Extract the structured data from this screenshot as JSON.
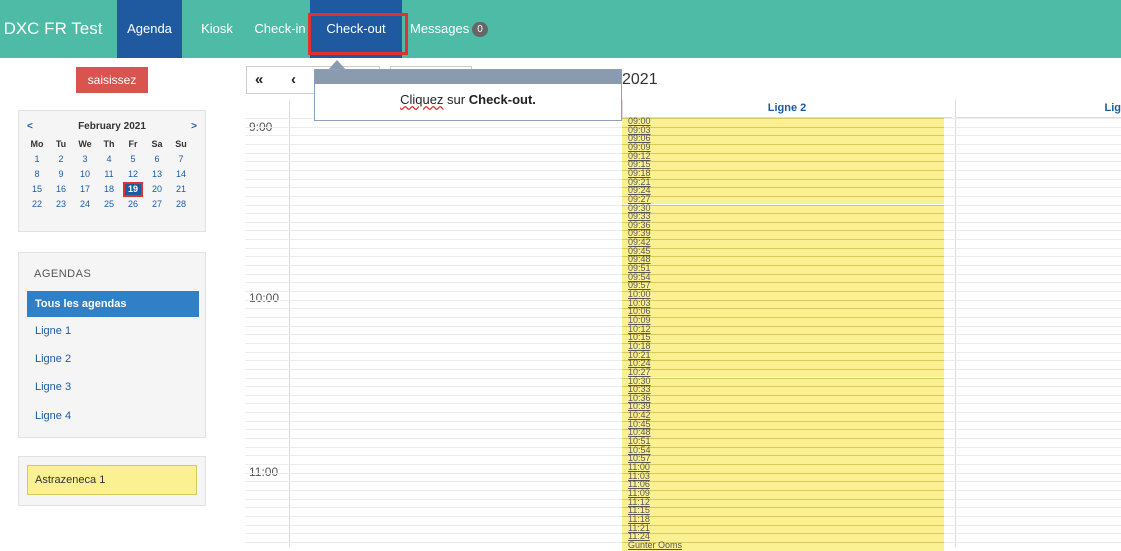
{
  "nav": {
    "brand": "DXC FR Test",
    "agenda": "Agenda",
    "kiosk": "Kiosk",
    "checkin": "Check-in",
    "checkout": "Check-out",
    "messages": "Messages",
    "messages_count": "0"
  },
  "sidebar": {
    "button": "saisissez",
    "calendar": {
      "prev": "<",
      "next": ">",
      "title": "February 2021",
      "dow": [
        "Mo",
        "Tu",
        "We",
        "Th",
        "Fr",
        "Sa",
        "Su"
      ],
      "weeks": [
        [
          "1",
          "2",
          "3",
          "4",
          "5",
          "6",
          "7"
        ],
        [
          "8",
          "9",
          "10",
          "11",
          "12",
          "13",
          "14"
        ],
        [
          "15",
          "16",
          "17",
          "18",
          "19",
          "20",
          "21"
        ],
        [
          "22",
          "23",
          "24",
          "25",
          "26",
          "27",
          "28"
        ]
      ],
      "selected": "19"
    },
    "agendas_title": "AGENDAS",
    "agendas": [
      "Tous les agendas",
      "Ligne 1",
      "Ligne 2",
      "Ligne 3",
      "Ligne 4"
    ],
    "event_box": "Astrazeneca 1"
  },
  "toolbar": {
    "first": "«",
    "prev": "‹",
    "date_title": "2021"
  },
  "tooltip": {
    "text_a": "Cliquez",
    "text_b": " sur ",
    "text_c": "Check-out."
  },
  "grid": {
    "columns": [
      "Ligne 2",
      "Lig"
    ],
    "hours": [
      "9:00",
      "10:00",
      "11:00"
    ],
    "slots": [
      "09:00",
      "09:03",
      "09:06",
      "09:09",
      "09:12",
      "09:15",
      "09:18",
      "09:21",
      "09:24",
      "09:27",
      "09:30",
      "09:33",
      "09:36",
      "09:39",
      "09:42",
      "09:45",
      "09:48",
      "09:51",
      "09:54",
      "09:57",
      "10:00",
      "10:03",
      "10:06",
      "10:09",
      "10:12",
      "10:15",
      "10:18",
      "10:21",
      "10:24",
      "10:27",
      "10:30",
      "10:33",
      "10:36",
      "10:39",
      "10:42",
      "10:45",
      "10:48",
      "10:51",
      "10:54",
      "10:57",
      "11:00",
      "11:03",
      "11:06",
      "11:09",
      "11:12",
      "11:15",
      "11:18",
      "11:21",
      "11:24"
    ],
    "last_slot": "Gunter Ooms"
  },
  "colors": {
    "topnav": "#4dbba6",
    "active_nav": "#1f5aa0",
    "slot_fill": "#fbf193",
    "highlight": "#e03030"
  }
}
